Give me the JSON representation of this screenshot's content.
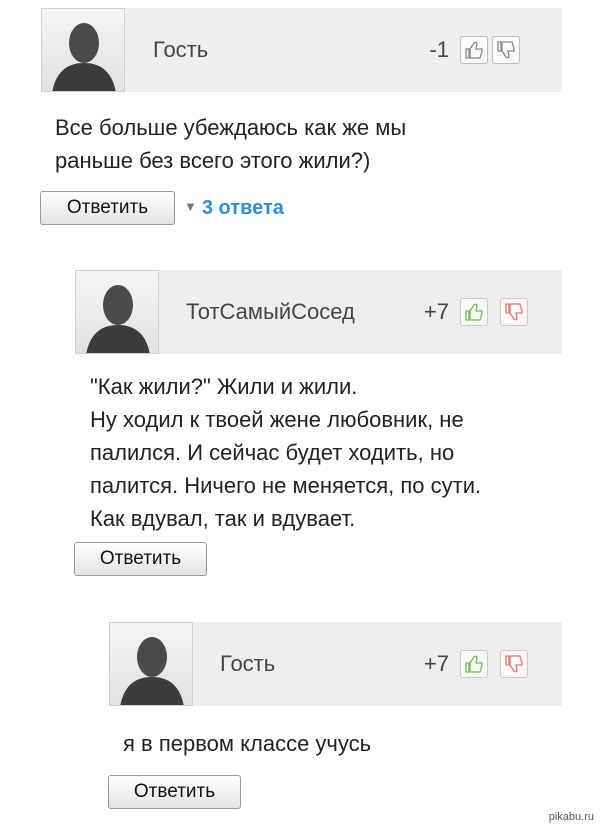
{
  "comments": [
    {
      "username": "Гость",
      "score": "-1",
      "text_lines": [
        "Все больше убеждаюсь как же мы",
        "раньше без всего этого жили?)"
      ],
      "reply_label": "Ответить",
      "replies_toggle": "3 ответа",
      "vote_colors": {
        "up": "#888888",
        "down": "#888888"
      }
    },
    {
      "username": "ТотСамыйСосед",
      "score": "+7",
      "text_lines": [
        "\"Как жили?\" Жили и жили.",
        "Ну ходил к твоей жене любовник, не",
        "палился. И сейчас будет ходить, но",
        "палится. Ничего не меняется, по сути.",
        "Как вдувал, так и вдувает."
      ],
      "reply_label": "Ответить",
      "vote_colors": {
        "up": "#6abf4b",
        "down": "#e07a6a"
      }
    },
    {
      "username": "Гость",
      "score": "+7",
      "text_lines": [
        "я в первом классе учусь"
      ],
      "reply_label": "Ответить",
      "vote_colors": {
        "up": "#6abf4b",
        "down": "#e07a6a"
      }
    }
  ],
  "icons": {
    "avatar": "default-avatar-icon",
    "thumbs_up": "thumbs-up-icon",
    "thumbs_down": "thumbs-down-icon",
    "toggle": "triangle-down-icon"
  },
  "watermark": "pikabu.ru"
}
